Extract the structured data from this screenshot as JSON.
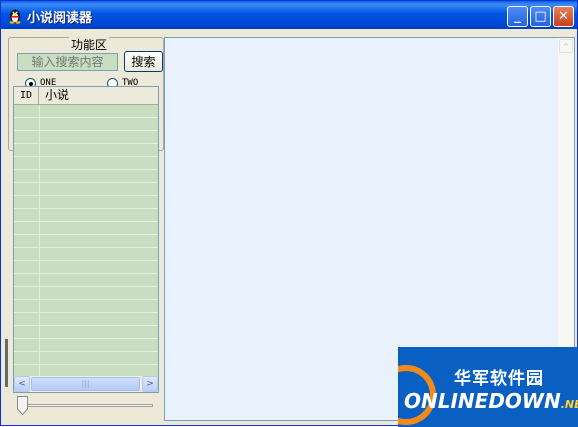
{
  "window": {
    "title": "小说阅读器",
    "minimize_symbol": "_",
    "maximize_symbol": "□",
    "close_symbol": "✕"
  },
  "function_panel": {
    "group_title": "功能区",
    "search_placeholder": "输入搜索内容",
    "search_button": "搜索",
    "radio_one": "ONE",
    "radio_two": "TWO",
    "selected_radio": "ONE"
  },
  "novel_list": {
    "columns": [
      "ID",
      "小说"
    ],
    "rows": []
  },
  "scrollbar": {
    "left_arrow": "<",
    "right_arrow": ">",
    "thumb_grip": "|||",
    "up_arrow": "^"
  },
  "slider": {
    "value": 0
  },
  "watermark": {
    "cn_text": "华军软件园",
    "en_text": "ONLINEDOWN",
    "en_suffix": ".NET"
  },
  "colors": {
    "title_bar": "#0054e3",
    "list_background": "#c7dfc0",
    "content_background": "#e9f2fc",
    "watermark_blue": "#0a60c2",
    "watermark_orange": "#f28a1a"
  }
}
